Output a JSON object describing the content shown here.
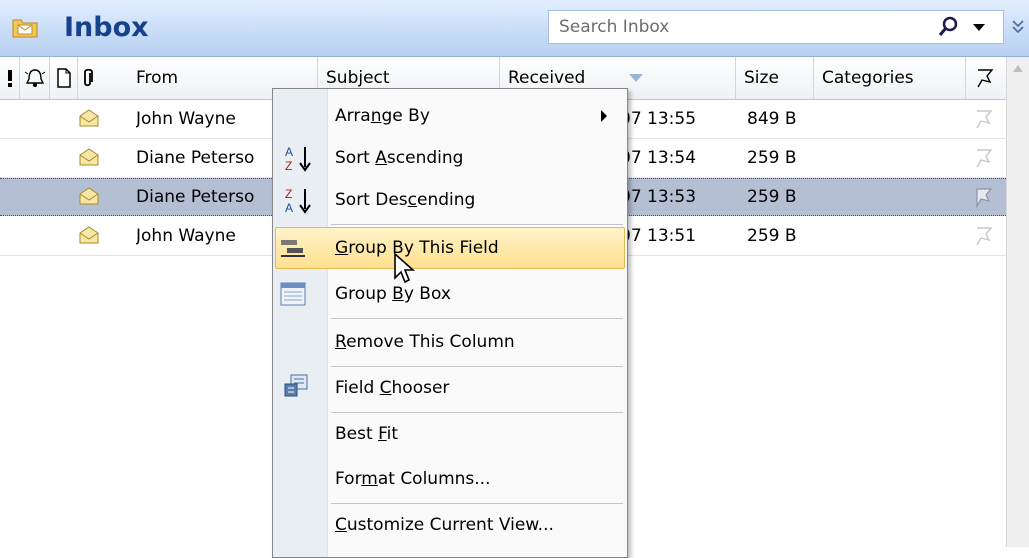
{
  "header": {
    "title": "Inbox",
    "search_placeholder": "Search Inbox"
  },
  "columns": {
    "from": "From",
    "subject": "Subject",
    "received": "Received",
    "size": "Size",
    "categories": "Categories"
  },
  "messages": [
    {
      "from": "John Wayne",
      "received": "07 13:55",
      "size": "849 B",
      "selected": false
    },
    {
      "from": "Diane Peterso",
      "received": "07 13:54",
      "size": "259 B",
      "selected": false
    },
    {
      "from": "Diane Peterso",
      "received": "07 13:53",
      "size": "259 B",
      "selected": true
    },
    {
      "from": "John Wayne",
      "received": "07 13:51",
      "size": "259 B",
      "selected": false
    }
  ],
  "context_menu": {
    "arrange_by": {
      "pre": "Arra",
      "key": "n",
      "post": "ge By"
    },
    "sort_ascending": {
      "pre": "Sort ",
      "key": "A",
      "post": "scending"
    },
    "sort_descending": {
      "pre": "Sort Des",
      "key": "c",
      "post": "ending"
    },
    "group_by_field": {
      "pre": "",
      "key": "G",
      "post": "roup By This Field"
    },
    "group_by_box": {
      "pre": "Group ",
      "key": "B",
      "post": "y Box"
    },
    "remove_column": {
      "pre": "",
      "key": "R",
      "post": "emove This Column"
    },
    "field_chooser": {
      "pre": "Field ",
      "key": "C",
      "post": "hooser"
    },
    "best_fit": {
      "pre": "Best ",
      "key": "F",
      "post": "it"
    },
    "format_columns": {
      "pre": "For",
      "key": "m",
      "post": "at Columns..."
    },
    "customize_view": {
      "pre": "",
      "key": "C",
      "post": "ustomize Current View..."
    }
  },
  "colors": {
    "title": "#15428b",
    "selected_row": "#b4bfd3",
    "menu_hover": "#ffe08f"
  }
}
